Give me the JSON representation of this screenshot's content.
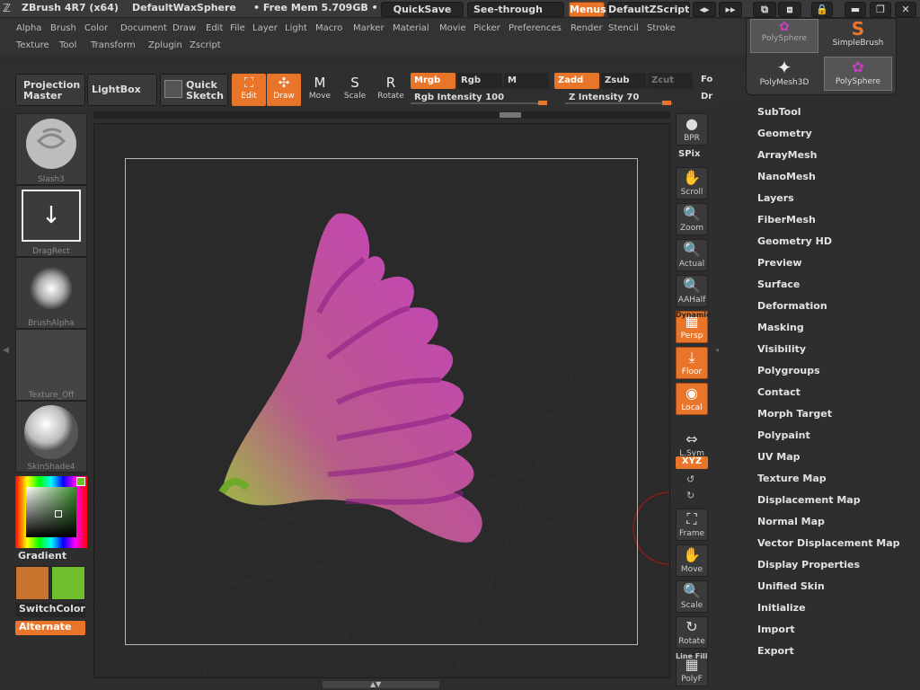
{
  "title_bar": {
    "app_name": "ZBrush 4R7 (x64)",
    "document": "DefaultWaxSphere",
    "free_mem": "• Free Mem 5.709GB •",
    "quicksave": "QuickSave",
    "see_through_label": "See-through",
    "see_through_value": "0",
    "menus": "Menus",
    "zscript": "DefaultZScript"
  },
  "menu_row1": [
    "Alpha",
    "Brush",
    "Color",
    "Document",
    "Draw",
    "Edit",
    "File",
    "Layer",
    "Light",
    "Macro",
    "Marker",
    "Material",
    "Movie",
    "Picker",
    "Preferences",
    "Render",
    "Stencil",
    "Stroke"
  ],
  "menu_row2": [
    "Texture",
    "Tool",
    "Transform",
    "Zplugin",
    "Zscript"
  ],
  "shelf": {
    "projection_master_1": "Projection",
    "projection_master_2": "Master",
    "lightbox": "LightBox",
    "quick_sketch_1": "Quick",
    "quick_sketch_2": "Sketch",
    "edit": "Edit",
    "draw": "Draw",
    "move": "Move",
    "scale": "Scale",
    "rotate": "Rotate",
    "mrgb": "Mrgb",
    "rgb": "Rgb",
    "m": "M",
    "zadd": "Zadd",
    "zsub": "Zsub",
    "zcut": "Zcut",
    "fo": "Fo",
    "dr": "Dr",
    "rgb_intensity_label": "Rgb Intensity",
    "rgb_intensity_value": "100",
    "z_intensity_label": "Z Intensity",
    "z_intensity_value": "70",
    "move_key": "M",
    "scale_key": "S",
    "rotate_key": "R"
  },
  "left_panel": {
    "brush": "Slash3",
    "stroke": "DragRect",
    "alpha": "BrushAlpha",
    "texture": "Texture_Off",
    "material": "SkinShade4",
    "gradient": "Gradient",
    "switch_color": "SwitchColor",
    "alternate": "Alternate",
    "colors": {
      "primary": "#c8732e",
      "secondary": "#6fbf2d"
    }
  },
  "right_tools": [
    {
      "id": "bpr",
      "label": "BPR",
      "on": false
    },
    {
      "id": "scroll",
      "label": "Scroll",
      "on": false
    },
    {
      "id": "zoom",
      "label": "Zoom",
      "on": false
    },
    {
      "id": "actual",
      "label": "Actual",
      "on": false
    },
    {
      "id": "aahalf",
      "label": "AAHalf",
      "on": false
    },
    {
      "id": "persp",
      "label": "Persp",
      "on": true
    },
    {
      "id": "floor",
      "label": "Floor",
      "on": true
    },
    {
      "id": "local",
      "label": "Local",
      "on": true
    },
    {
      "id": "lsym",
      "label": "L.Sym",
      "on": false
    },
    {
      "id": "frame",
      "label": "Frame",
      "on": false
    },
    {
      "id": "move",
      "label": "Move",
      "on": false
    },
    {
      "id": "scale",
      "label": "Scale",
      "on": false
    },
    {
      "id": "rotate",
      "label": "Rotate",
      "on": false
    },
    {
      "id": "polyf",
      "label": "PolyF",
      "on": false
    }
  ],
  "right_tool_extras": {
    "spix": "SPix",
    "dynamic": "Dynamic",
    "xyz": "XYZ",
    "line_fill": "Line Fill"
  },
  "tool_popup": {
    "items": [
      "PolySphere",
      "SimpleBrush",
      "PolyMesh3D",
      "PolySphere"
    ]
  },
  "tool_palette": [
    "SubTool",
    "Geometry",
    "ArrayMesh",
    "NanoMesh",
    "Layers",
    "FiberMesh",
    "Geometry HD",
    "Preview",
    "Surface",
    "Deformation",
    "Masking",
    "Visibility",
    "Polygroups",
    "Contact",
    "Morph Target",
    "Polypaint",
    "UV Map",
    "Texture Map",
    "Displacement Map",
    "Normal Map",
    "Vector Displacement Map",
    "Display Properties",
    "Unified Skin",
    "Initialize",
    "Import",
    "Export"
  ],
  "accent": "#e8752a",
  "mesh_color": "#c93fc2"
}
